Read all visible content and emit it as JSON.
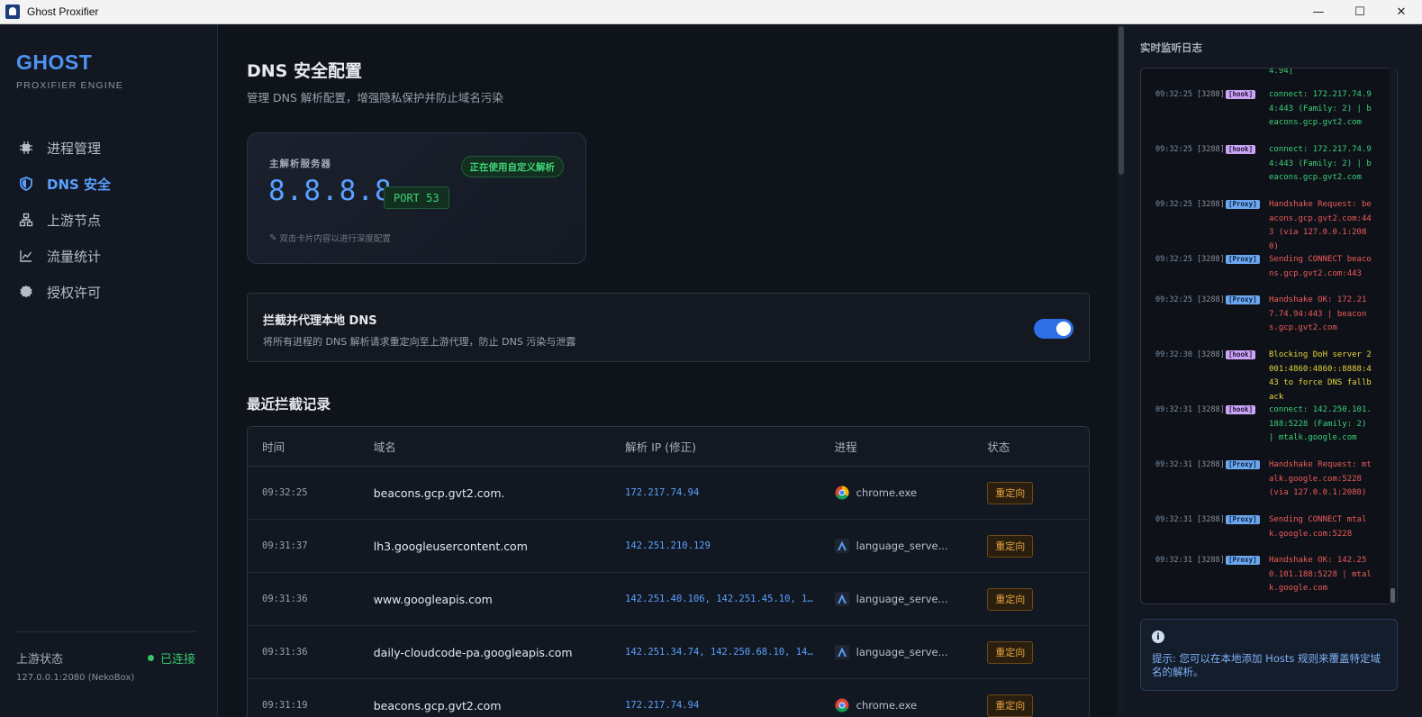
{
  "window": {
    "title": "Ghost Proxifier",
    "controls": [
      "—",
      "☐",
      "✕"
    ]
  },
  "sidebar": {
    "brand": "GHOST",
    "brand_sub": "PROXIFIER ENGINE",
    "items": [
      {
        "label": "进程管理",
        "icon": "cpu-icon"
      },
      {
        "label": "DNS 安全",
        "icon": "shield-icon"
      },
      {
        "label": "上游节点",
        "icon": "network-icon"
      },
      {
        "label": "流量统计",
        "icon": "chart-icon"
      },
      {
        "label": "授权许可",
        "icon": "badge-icon"
      }
    ],
    "active_index": 1,
    "upstream_label": "上游状态",
    "upstream_status": "已连接",
    "upstream_addr": "127.0.0.1:2080 (NekoBox)",
    "status_color": "#35c46a"
  },
  "main": {
    "title": "DNS 安全配置",
    "subtitle": "管理 DNS 解析配置，增强隐私保护并防止域名污染",
    "dns_card": {
      "label": "主解析服务器",
      "badge": "正在使用自定义解析",
      "ip": "8.8.8.8",
      "port": "PORT 53",
      "hint": "双击卡片内容以进行深度配置"
    },
    "intercept": {
      "title": "拦截并代理本地 DNS",
      "desc": "将所有进程的 DNS 解析请求重定向至上游代理，防止 DNS 污染与泄露",
      "enabled": true
    },
    "records_title": "最近拦截记录",
    "table": {
      "headers": [
        "时间",
        "域名",
        "解析 IP (修正)",
        "进程",
        "状态"
      ],
      "rows": [
        {
          "time": "09:32:25",
          "domain": "beacons.gcp.gvt2.com.",
          "ip": "172.217.74.94",
          "process": "chrome.exe",
          "proc_icon": "chrome-icon",
          "status": "重定向"
        },
        {
          "time": "09:31:37",
          "domain": "lh3.googleusercontent.com",
          "ip": "142.251.210.129",
          "process": "language_serve...",
          "proc_icon": "language-server-icon",
          "status": "重定向"
        },
        {
          "time": "09:31:36",
          "domain": "www.googleapis.com",
          "ip": "142.251.40.106, 142.251.45.10, 142…",
          "process": "language_serve...",
          "proc_icon": "language-server-icon",
          "status": "重定向"
        },
        {
          "time": "09:31:36",
          "domain": "daily-cloudcode-pa.googleapis.com",
          "ip": "142.251.34.74, 142.250.68.10, 142.…",
          "process": "language_serve...",
          "proc_icon": "language-server-icon",
          "status": "重定向"
        },
        {
          "time": "09:31:19",
          "domain": "beacons.gcp.gvt2.com",
          "ip": "172.217.74.94",
          "process": "chrome.exe",
          "proc_icon": "chrome-icon",
          "status": "重定向"
        }
      ]
    }
  },
  "log_panel": {
    "title": "实时监听日志",
    "top_fragment": "4.94]",
    "entries": [
      {
        "ts": "09:32:25",
        "pid": "[3288]",
        "level": "[hook]",
        "msg": "connect: 172.217.74.94:443 (Family: 2) | beacons.gcp.gvt2.com",
        "color": "#3ccf7a"
      },
      {
        "ts": "09:32:25",
        "pid": "[3288]",
        "level": "[hook]",
        "msg": "connect: 172.217.74.94:443 (Family: 2) | beacons.gcp.gvt2.com",
        "color": "#3ccf7a"
      },
      {
        "ts": "09:32:25",
        "pid": "[3288]",
        "level": "[Proxy]",
        "msg": "Handshake Request: beacons.gcp.gvt2.com:443 (via 127.0.0.1:2080)",
        "color": "#ee5a5a"
      },
      {
        "ts": "09:32:25",
        "pid": "[3288]",
        "level": "[Proxy]",
        "msg": "Sending CONNECT beacons.gcp.gvt2.com:443",
        "color": "#ee5a5a"
      },
      {
        "ts": "09:32:25",
        "pid": "[3288]",
        "level": "[Proxy]",
        "msg": "Handshake OK: 172.217.74.94:443 | beacons.gcp.gvt2.com",
        "color": "#ee5a5a"
      },
      {
        "ts": "09:32:30",
        "pid": "[3288]",
        "level": "[hook]",
        "msg": "Blocking DoH server 2001:4860:4860::8888:443 to force DNS fallback",
        "color": "#e6d33c"
      },
      {
        "ts": "09:32:31",
        "pid": "[3288]",
        "level": "[hook]",
        "msg": "connect: 142.250.101.188:5228 (Family: 2) | mtalk.google.com",
        "color": "#3ccf7a"
      },
      {
        "ts": "09:32:31",
        "pid": "[3288]",
        "level": "[Proxy]",
        "msg": "Handshake Request: mtalk.google.com:5228 (via 127.0.0.1:2080)",
        "color": "#ee5a5a"
      },
      {
        "ts": "09:32:31",
        "pid": "[3288]",
        "level": "[Proxy]",
        "msg": "Sending CONNECT mtalk.google.com:5228",
        "color": "#ee5a5a"
      },
      {
        "ts": "09:32:31",
        "pid": "[3288]",
        "level": "[Proxy]",
        "msg": "Handshake OK: 142.250.101.188:5228 | mtalk.google.com",
        "color": "#ee5a5a"
      }
    ],
    "tip": "提示: 您可以在本地添加 Hosts 规则来覆盖特定域名的解析。"
  }
}
